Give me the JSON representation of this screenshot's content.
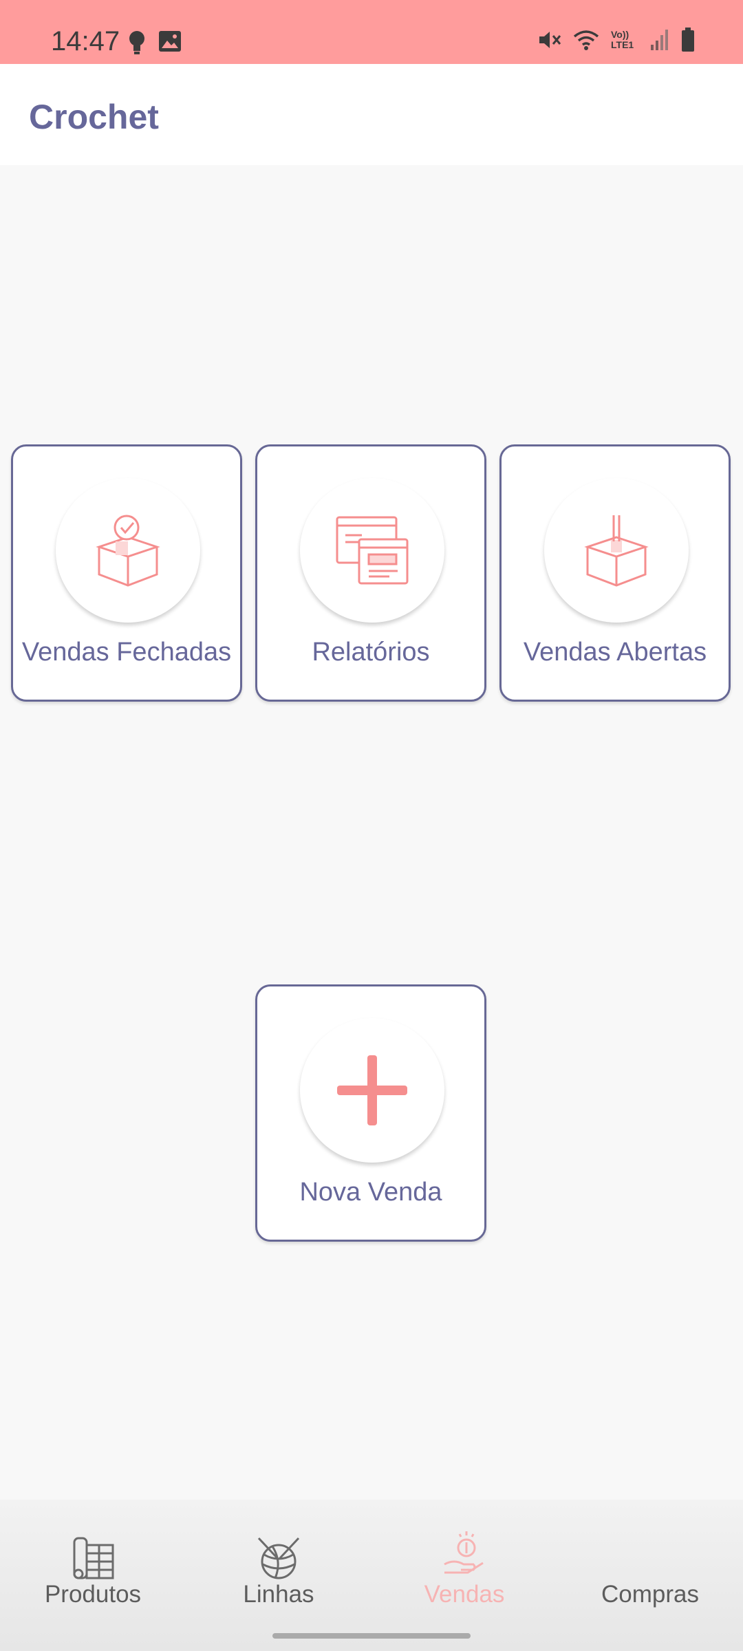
{
  "status_bar": {
    "time": "14:47",
    "network_label": "Vo)) LTE1"
  },
  "app_bar": {
    "title": "Crochet"
  },
  "cards": {
    "closed_sales": {
      "label": "Vendas Fechadas",
      "icon": "box-check-icon"
    },
    "reports": {
      "label": "Relatórios",
      "icon": "report-icon"
    },
    "open_sales": {
      "label": "Vendas Abertas",
      "icon": "open-box-icon"
    },
    "new_sale": {
      "label": "Nova Venda",
      "icon": "plus-icon"
    }
  },
  "bottom_nav": {
    "items": [
      {
        "label": "Produtos",
        "icon": "products-icon",
        "active": false
      },
      {
        "label": "Linhas",
        "icon": "yarn-icon",
        "active": false
      },
      {
        "label": "Vendas",
        "icon": "sales-icon",
        "active": true
      },
      {
        "label": "Compras",
        "icon": "purchases-icon",
        "active": false
      }
    ]
  },
  "colors": {
    "status_bar": "#ff9c9c",
    "primary_text": "#66679a",
    "icon_pink": "#f58e8e",
    "card_border": "#676895"
  }
}
